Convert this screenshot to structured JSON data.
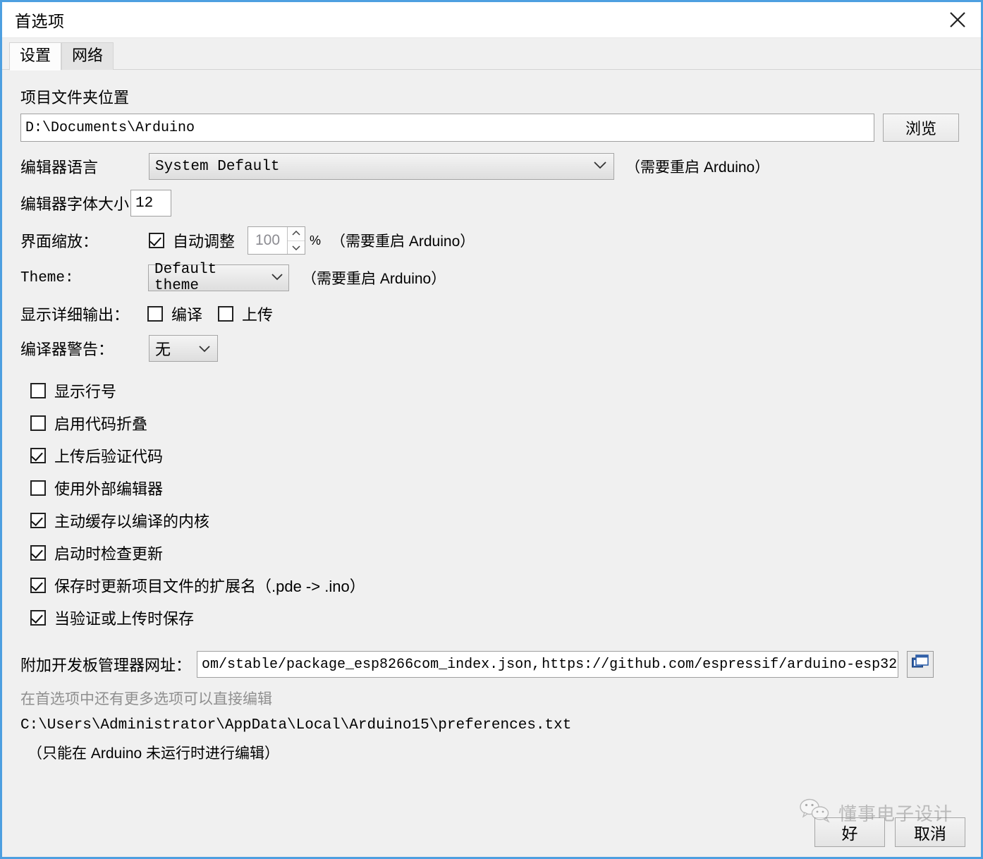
{
  "window": {
    "title": "首选项",
    "close_icon": "close-icon"
  },
  "tabs": [
    {
      "label": "设置",
      "active": true
    },
    {
      "label": "网络",
      "active": false
    }
  ],
  "sketchbook": {
    "label": "项目文件夹位置",
    "path": "D:\\Documents\\Arduino",
    "browse_label": "浏览"
  },
  "language": {
    "label": "编辑器语言",
    "value": "System Default",
    "restart_hint": "（需要重启 Arduino）"
  },
  "font_size": {
    "label": "编辑器字体大小",
    "value": "12"
  },
  "scaling": {
    "label": "界面缩放：",
    "auto_label": "自动调整",
    "auto_checked": true,
    "percent_value": "100",
    "percent_sign": "%",
    "restart_hint": "（需要重启 Arduino）"
  },
  "theme": {
    "label": "Theme:",
    "value": "Default theme",
    "restart_hint": "（需要重启 Arduino）"
  },
  "verbose": {
    "label": "显示详细输出：",
    "compile_label": "编译",
    "compile_checked": false,
    "upload_label": "上传",
    "upload_checked": false
  },
  "warnings": {
    "label": "编译器警告：",
    "value": "无"
  },
  "options": [
    {
      "label": "显示行号",
      "checked": false
    },
    {
      "label": "启用代码折叠",
      "checked": false
    },
    {
      "label": "上传后验证代码",
      "checked": true
    },
    {
      "label": "使用外部编辑器",
      "checked": false
    },
    {
      "label": "主动缓存以编译的内核",
      "checked": true
    },
    {
      "label": "启动时检查更新",
      "checked": true
    },
    {
      "label": "保存时更新项目文件的扩展名（.pde -> .ino）",
      "checked": true
    },
    {
      "label": "当验证或上传时保存",
      "checked": true
    }
  ],
  "board_urls": {
    "label": "附加开发板管理器网址：",
    "value_before_caret": "om/stable/package_esp8266com_index.json,",
    "value_after_caret": "https://github.com/espressif/arduino-esp32",
    "edit_icon": "open-window-icon"
  },
  "footnotes": {
    "more_prefs": "在首选项中还有更多选项可以直接编辑",
    "prefs_path": "C:\\Users\\Administrator\\AppData\\Local\\Arduino15\\preferences.txt",
    "edit_note": "（只能在 Arduino 未运行时进行编辑）"
  },
  "footer": {
    "ok_label": "好",
    "cancel_label": "取消"
  },
  "watermark": {
    "text": "懂事电子设计",
    "icon": "wechat-icon"
  },
  "colors": {
    "window_border": "#4d9fe0",
    "panel_bg": "#f0f0f0",
    "field_bg": "#ffffff",
    "field_border": "#a0a0a0",
    "icon_blue": "#2f5fa8"
  }
}
